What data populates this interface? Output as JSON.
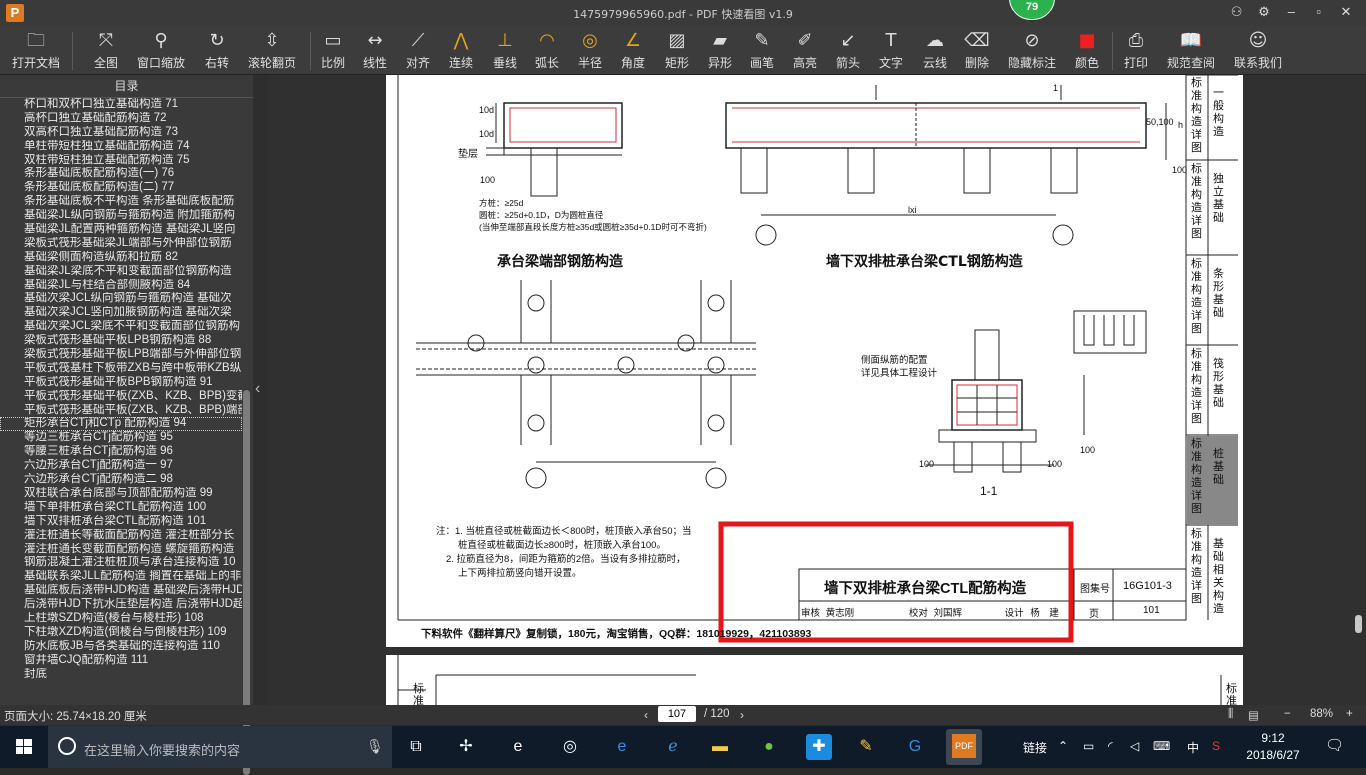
{
  "window": {
    "title": "1475979965960.pdf - PDF 快速看图 v1.9",
    "app_icon": "P",
    "badge": "79"
  },
  "toolbar": [
    {
      "label": "打开文档",
      "icon": "folder-icon",
      "glyph": "🗀"
    },
    {
      "label": "全图",
      "icon": "fit-page-icon",
      "glyph": "⤧"
    },
    {
      "label": "窗口缩放",
      "icon": "zoom-icon",
      "glyph": "⚲"
    },
    {
      "label": "右转",
      "icon": "rotate-icon",
      "glyph": "↻"
    },
    {
      "label": "滚轮翻页",
      "icon": "mouse-icon",
      "glyph": "⇳"
    },
    {
      "label": "比例",
      "icon": "scale-icon",
      "glyph": "▭"
    },
    {
      "label": "线性",
      "icon": "linear-measure-icon",
      "glyph": "↔"
    },
    {
      "label": "对齐",
      "icon": "align-measure-icon",
      "glyph": "⟋"
    },
    {
      "label": "连续",
      "icon": "continuous-measure-icon",
      "glyph": "⋀"
    },
    {
      "label": "垂线",
      "icon": "perpendicular-icon",
      "glyph": "⊥"
    },
    {
      "label": "弧长",
      "icon": "arc-length-icon",
      "glyph": "◠"
    },
    {
      "label": "半径",
      "icon": "radius-icon",
      "glyph": "◎"
    },
    {
      "label": "角度",
      "icon": "angle-icon",
      "glyph": "∠"
    },
    {
      "label": "矩形",
      "icon": "rectangle-area-icon",
      "glyph": "▨"
    },
    {
      "label": "异形",
      "icon": "polygon-area-icon",
      "glyph": "▰"
    },
    {
      "label": "画笔",
      "icon": "pen-icon",
      "glyph": "✎"
    },
    {
      "label": "高亮",
      "icon": "highlighter-icon",
      "glyph": "✐"
    },
    {
      "label": "箭头",
      "icon": "arrow-icon",
      "glyph": "↙"
    },
    {
      "label": "文字",
      "icon": "text-icon",
      "glyph": "T"
    },
    {
      "label": "云线",
      "icon": "cloud-line-icon",
      "glyph": "☁"
    },
    {
      "label": "删除",
      "icon": "eraser-icon",
      "glyph": "⌫"
    },
    {
      "label": "隐藏标注",
      "icon": "hide-annotation-icon",
      "glyph": "⊘"
    },
    {
      "label": "颜色",
      "icon": "color-swatch-icon",
      "glyph": "■"
    },
    {
      "label": "打印",
      "icon": "printer-icon",
      "glyph": "⎙"
    },
    {
      "label": "规范查阅",
      "icon": "book-icon",
      "glyph": "📖"
    },
    {
      "label": "联系我们",
      "icon": "contact-icon",
      "glyph": "☺"
    }
  ],
  "sidebar": {
    "title": "目录",
    "items": [
      "杯口和双杯口独立基础构造 71",
      "高杯口独立基础配筋构造 72",
      "双高杯口独立基础配筋构造 73",
      "单柱带短柱独立基础配筋构造 74",
      "双柱带短柱独立基础配筋构造 75",
      "条形基础底板配筋构造(一) 76",
      "条形基础底板配筋构造(二) 77",
      "条形基础底板不平构造 条形基础底板配筋",
      "基础梁JL纵向钢筋与箍筋构造 附加箍筋构",
      "基础梁JL配置两种箍筋构造 基础梁JL竖向",
      "梁板式筏形基础梁JL端部与外伸部位钢筋",
      "基础梁侧面构造纵筋和拉筋 82",
      "基础梁JL梁底不平和变截面部位钢筋构造",
      "基础梁JL与柱结合部侧腋构造 84",
      "基础次梁JCL纵向钢筋与箍筋构造 基础次",
      "基础次梁JCL竖向加腋钢筋构造 基础次梁",
      "基础次梁JCL梁底不平和变截面部位钢筋构",
      "梁板式筏形基础平板LPB钢筋构造 88",
      "梁板式筏形基础平板LPB端部与外伸部位钢",
      "平板式筏基柱下板带ZXB与跨中板带KZB纵向",
      "平板式筏形基础平板BPB钢筋构造 91",
      "平板式筏形基础平板(ZXB、KZB、BPB)变截",
      "平板式筏形基础平板(ZXB、KZB、BPB)端部",
      "矩形承台CTj和CTp 配筋构造 94",
      "等边三桩承台CTj配筋构造 95",
      "等腰三桩承台CTj配筋构造 96",
      "六边形承台CTj配筋构造一 97",
      "六边形承台CTj配筋构造二 98",
      "双柱联合承台底部与顶部配筋构造 99",
      "墙下单排桩承台梁CTL配筋构造 100",
      "墙下双排桩承台梁CTL配筋构造 101",
      "灌注桩通长等截面配筋构造 灌注桩部分长",
      "灌注桩通长变截面配筋构造 螺旋箍筋构造",
      "钢筋混凝土灌注桩桩顶与承台连接构造 10",
      "基础联系梁JLL配筋构造 搁置在基础上的非",
      "基础底板后浇带HJD构造 基础梁后浇带HJD",
      "后浇带HJD下抗水压垫层构造 后浇带HJD超",
      "上柱墩SZD构造(棱台与棱柱形) 108",
      "下柱墩XZD构造(倒棱台与倒棱柱形) 109",
      "防水底板JB与各类基础的连接构造 110",
      "窗井墙CJQ配筋构造 111",
      "封底"
    ],
    "selected_index": 23
  },
  "drawing": {
    "caption_left": "承台梁端部钢筋构造",
    "caption_right": "墙下双排桩承台梁CTL钢筋构造",
    "section_label": "1-1",
    "title_block_title": "墙下双排桩承台梁CTL配筋构造",
    "atlas_label": "图集号",
    "atlas_no": "16G101-3",
    "page_label": "页",
    "page_no": "101",
    "signatures": [
      "审核",
      "黄志刚",
      "校对",
      "刘国辉",
      "设计",
      "杨　建"
    ],
    "side_tabs": [
      "标准构造详图 一般构造",
      "标准构造详图 独立基础",
      "标准构造详图 条形基础",
      "标准构造详图 筏形基础",
      "标准构造详图 桩基础",
      "标准构造详图 基础相关构造"
    ],
    "notes": [
      "注：1. 当桩直径或桩截面边长＜800时，桩顶嵌入承台50；当",
      "桩直径或桩截面边长≥800时，桩顶嵌入承台100。",
      "2. 拉筋直径为8，间距为箍筋的2倍。当设有多排拉筋时，",
      "上下两排拉筋竖向错开设置。"
    ],
    "side_note": [
      "侧面纵筋的配置",
      "详见具体工程设计"
    ],
    "pile_note": [
      "方桩：≥25d",
      "圆桩：≥25d+0.1D，D为圆桩直径",
      "(当伸至端部直段长度方桩≥35d或圆桩≥35d+0.1D时可不弯折)"
    ],
    "cushion": "垫层",
    "dims": [
      "100",
      "10d",
      "10d",
      "50,100",
      "h",
      "100",
      "lxi",
      "1",
      "100",
      "100",
      "100"
    ],
    "footer_ad": "下料软件《翻样算尺》复制锁，180元，淘宝销售，QQ群：181019929，421103893",
    "next_page_tab": "标准",
    "highlight_color": "#e8141b"
  },
  "status": {
    "page_size": "页面大小: 25.74×18.20 厘米",
    "current_page": "107",
    "total_pages": "/ 120",
    "zoom": "88%",
    "zoom_minus": "−",
    "zoom_plus": "+"
  },
  "taskbar": {
    "search_placeholder": "在这里输入你要搜索的内容",
    "link_label": "链接",
    "ime": "中",
    "time": "9:12",
    "date": "2018/6/27"
  }
}
